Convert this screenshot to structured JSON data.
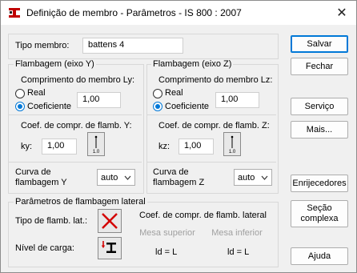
{
  "window": {
    "title": "Definição de membro - Parâmetros - IS 800 : 2007",
    "icons": {
      "app": "beam-app-icon",
      "close": "close-icon"
    },
    "close_glyph": "✕"
  },
  "member": {
    "type_label": "Tipo membro:",
    "type_value": "battens 4"
  },
  "buckling_y": {
    "group_title": "Flambagem (eixo Y)",
    "length_label": "Comprimento do membro Ly:",
    "real_label": "Real",
    "coef_label": "Coeficiente",
    "selected": "coeficiente",
    "length_value": "1,00",
    "coef_title": "Coef. de compr. de flamb. Y:",
    "k_label": "ky:",
    "k_value": "1,00",
    "k_icon": "column-support-icon",
    "curve_label": "Curva de flambagem Y",
    "curve_value": "auto"
  },
  "buckling_z": {
    "group_title": "Flambagem (eixo Z)",
    "length_label": "Comprimento do membro Lz:",
    "real_label": "Real",
    "coef_label": "Coeficiente",
    "selected": "coeficiente",
    "length_value": "1,00",
    "coef_title": "Coef. de compr. de flamb. Z:",
    "k_label": "kz:",
    "k_value": "1,00",
    "k_icon": "column-support-icon",
    "curve_label": "Curva de flambagem Z",
    "curve_value": "auto"
  },
  "lateral": {
    "group_title": "Parâmetros de flambagem lateral",
    "type_label": "Tipo de flamb. lat.:",
    "type_icon": "red-x-icon",
    "load_label": "Nível de carga:",
    "load_icon": "load-level-icon",
    "coef_title": "Coef. de compr. de flamb. lateral",
    "upper_flange": "Mesa superior",
    "lower_flange": "Mesa inferior",
    "ld_upper": "ld = L",
    "ld_lower": "ld = L"
  },
  "buttons": {
    "save": "Salvar",
    "close": "Fechar",
    "service": "Serviço",
    "more": "Mais...",
    "stiffeners": "Enrijecedores",
    "section": "Seção complexa",
    "help": "Ajuda"
  }
}
